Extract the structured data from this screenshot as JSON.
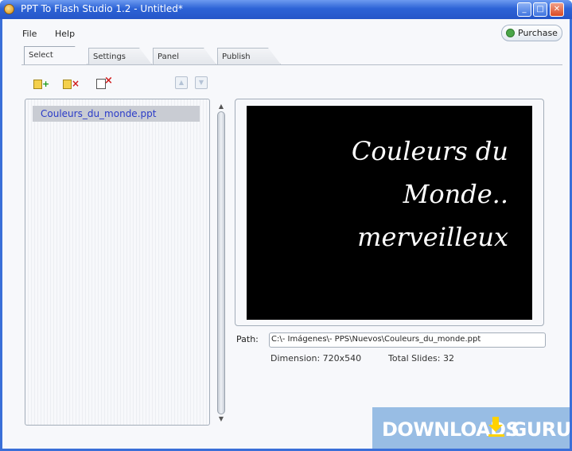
{
  "window": {
    "title": "PPT To Flash Studio 1.2 - Untitled*"
  },
  "menu": {
    "file": "File",
    "help": "Help"
  },
  "purchase_label": "Purchase",
  "tabs": [
    {
      "label": "Select",
      "active": true
    },
    {
      "label": "Settings"
    },
    {
      "label": "Panel"
    },
    {
      "label": "Publish"
    }
  ],
  "toolbar": {
    "add_icon": "add-file-icon",
    "remove_icon": "remove-file-icon",
    "clear_icon": "clear-list-icon",
    "move_up_icon": "arrow-up-icon",
    "move_down_icon": "arrow-down-icon"
  },
  "file_list": [
    "Couleurs_du_monde.ppt"
  ],
  "preview": {
    "slide_lines": [
      "Couleurs du",
      "Monde..",
      "merveilleux"
    ]
  },
  "path": {
    "label": "Path:",
    "value": "C:\\- Imágenes\\- PPS\\Nuevos\\Couleurs_du_monde.ppt"
  },
  "info": {
    "dimension": "Dimension: 720x540",
    "total_slides": "Total Slides: 32"
  },
  "watermark": {
    "left": "DOWNLOADS",
    "right": ".GURU"
  }
}
